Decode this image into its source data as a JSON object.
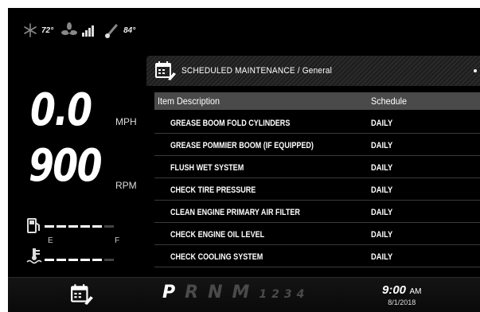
{
  "status": {
    "cab_temp": "72°",
    "outside_temp": "84°",
    "icons": [
      "snowflake-icon",
      "fan-icon",
      "signal-bars-icon",
      "thermometer-icon"
    ]
  },
  "gauges": {
    "speed_value": "0.0",
    "speed_unit": "MPH",
    "rpm_value": "900",
    "rpm_unit": "RPM",
    "fuel_empty": "E",
    "fuel_full": "F",
    "fuel_level_fraction": 0.8,
    "coolant_level_fraction": 0.8
  },
  "panel": {
    "title": "SCHEDULED MAINTENANCE / General",
    "columns": [
      "Item Description",
      "Schedule"
    ],
    "rows": [
      {
        "item": "GREASE BOOM FOLD CYLINDERS",
        "schedule": "DAILY"
      },
      {
        "item": "GREASE POMMIER BOOM (IF EQUIPPED)",
        "schedule": "DAILY"
      },
      {
        "item": "FLUSH WET SYSTEM",
        "schedule": "DAILY"
      },
      {
        "item": "CHECK TIRE PRESSURE",
        "schedule": "DAILY"
      },
      {
        "item": "CLEAN ENGINE PRIMARY AIR FILTER",
        "schedule": "DAILY"
      },
      {
        "item": "CHECK ENGINE OIL LEVEL",
        "schedule": "DAILY"
      },
      {
        "item": "CHECK COOLING SYSTEM",
        "schedule": "DAILY"
      }
    ]
  },
  "bottom": {
    "gears": [
      "P",
      "R",
      "N",
      "M"
    ],
    "active_gear": "P",
    "gear_numbers": "1234",
    "time": "9:00",
    "ampm": "AM",
    "date": "8/1/2018"
  },
  "colors": {
    "background": "#000000",
    "accent": "#ffffff",
    "header_row": "#4a4a4a"
  }
}
